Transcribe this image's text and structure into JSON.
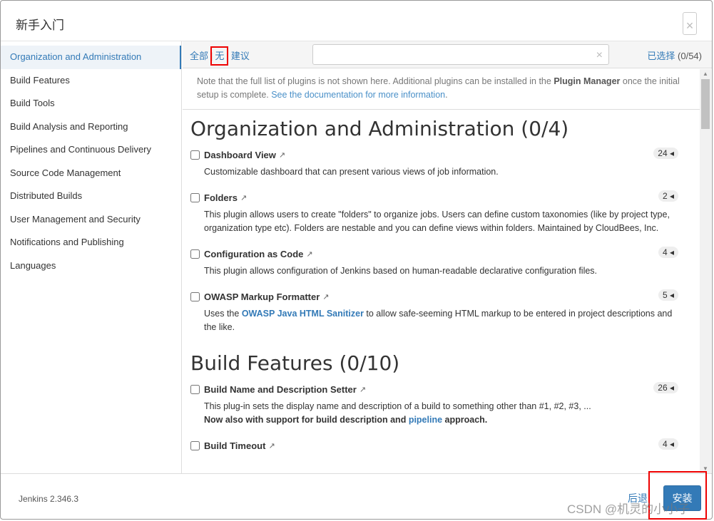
{
  "dialog": {
    "title": "新手入门",
    "close": "×"
  },
  "sidebar": {
    "items": [
      {
        "label": "Organization and Administration",
        "active": true
      },
      {
        "label": "Build Features"
      },
      {
        "label": "Build Tools"
      },
      {
        "label": "Build Analysis and Reporting"
      },
      {
        "label": "Pipelines and Continuous Delivery"
      },
      {
        "label": "Source Code Management"
      },
      {
        "label": "Distributed Builds"
      },
      {
        "label": "User Management and Security"
      },
      {
        "label": "Notifications and Publishing"
      },
      {
        "label": "Languages"
      }
    ]
  },
  "toolbar": {
    "all": "全部",
    "none": "无",
    "suggested": "建议",
    "sep": "|",
    "search_value": "",
    "clear": "×",
    "selected_label": "已选择",
    "selected_count": "(0/54)"
  },
  "note": {
    "text1": "Note that the full list of plugins is not shown here. Additional plugins can be installed in the ",
    "bold": "Plugin Manager",
    "text2": " once the initial setup is complete. ",
    "link": "See the documentation for more information",
    "end": "."
  },
  "sections": [
    {
      "title": "Organization and Administration (0/4)",
      "plugins": [
        {
          "name": "Dashboard View",
          "deps": "24",
          "desc": "Customizable dashboard that can present various views of job information."
        },
        {
          "name": "Folders",
          "deps": "2",
          "desc": "This plugin allows users to create \"folders\" to organize jobs. Users can define custom taxonomies (like by project type, organization type etc). Folders are nestable and you can define views within folders. Maintained by CloudBees, Inc."
        },
        {
          "name": "Configuration as Code",
          "deps": "4",
          "desc": "This plugin allows configuration of Jenkins based on human-readable declarative configuration files."
        },
        {
          "name": "OWASP Markup Formatter",
          "deps": "5",
          "desc_pre": "Uses the ",
          "desc_link": "OWASP Java HTML Sanitizer",
          "desc_post": " to allow safe-seeming HTML markup to be entered in project descriptions and the like."
        }
      ]
    },
    {
      "title": "Build Features (0/10)",
      "plugins": [
        {
          "name": "Build Name and Description Setter",
          "deps": "26",
          "desc": "This plug-in sets the display name and description of a build to something other than #1, #2, #3, ...",
          "desc2_pre": "Now also with support for build description and ",
          "desc2_link": "pipeline",
          "desc2_post": " approach."
        },
        {
          "name": "Build Timeout",
          "deps": "4"
        }
      ]
    }
  ],
  "footer": {
    "version": "Jenkins 2.346.3",
    "back": "后退",
    "install": "安装"
  },
  "watermark": "CSDN @机灵的小小子",
  "icons": {
    "external": "↗",
    "badge_arrow": "◂"
  }
}
